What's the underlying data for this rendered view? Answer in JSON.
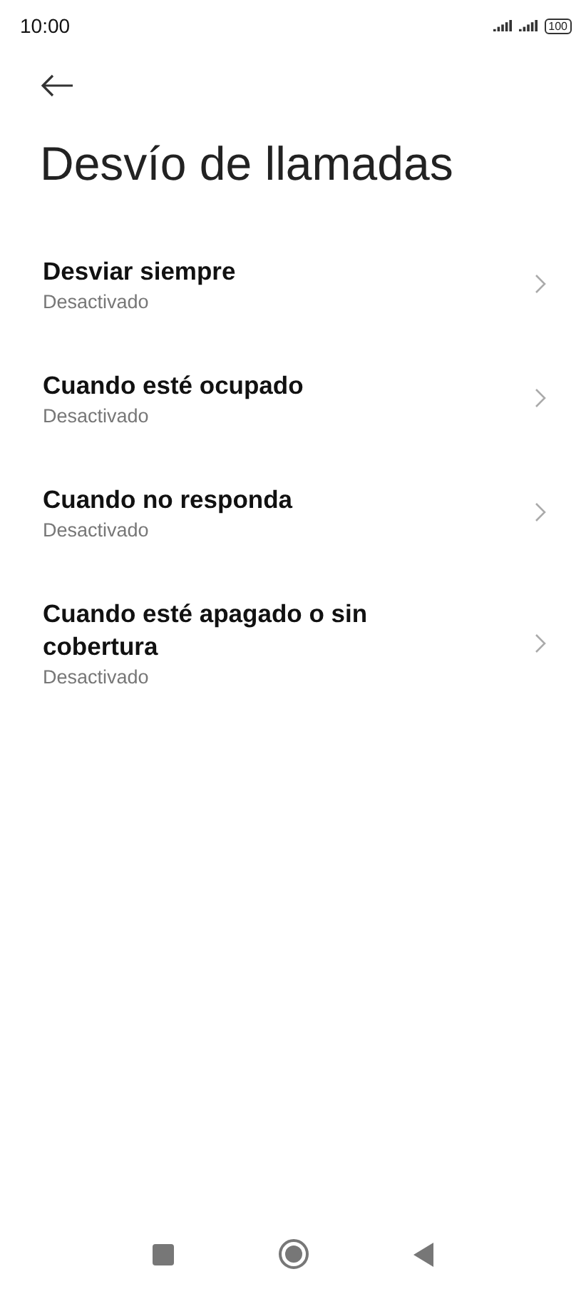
{
  "status_bar": {
    "time": "10:00",
    "battery": "100"
  },
  "title": "Desvío de llamadas",
  "items": [
    {
      "title": "Desviar siempre",
      "subtitle": "Desactivado"
    },
    {
      "title": "Cuando esté ocupado",
      "subtitle": "Desactivado"
    },
    {
      "title": "Cuando no responda",
      "subtitle": "Desactivado"
    },
    {
      "title": "Cuando esté apagado o sin cobertura",
      "subtitle": "Desactivado"
    }
  ]
}
